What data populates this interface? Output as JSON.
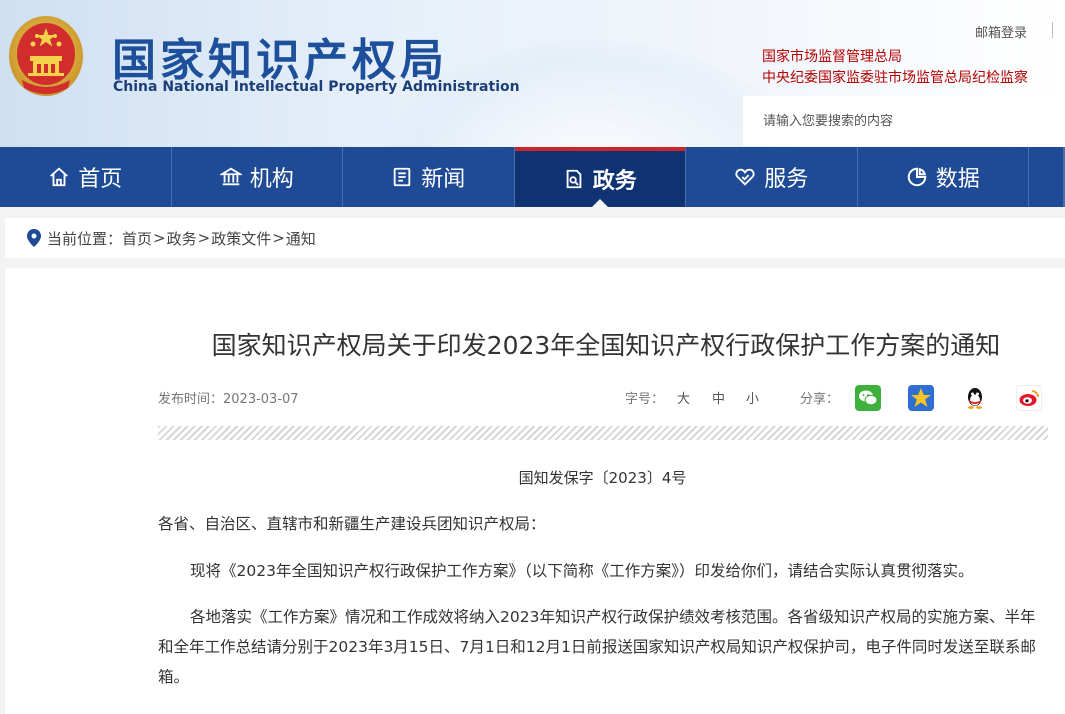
{
  "header": {
    "title": "国家知识产权局",
    "subtitle": "China National Intellectual Property Administration",
    "email_login": "邮箱登录",
    "related_links": [
      "国家市场监督管理总局",
      "中央纪委国家监委驻市场监管总局纪检监察"
    ],
    "search_placeholder": "请输入您要搜索的内容"
  },
  "nav": {
    "items": [
      {
        "label": "首页",
        "icon": "home-icon"
      },
      {
        "label": "机构",
        "icon": "institution-icon"
      },
      {
        "label": "新闻",
        "icon": "news-icon"
      },
      {
        "label": "政务",
        "icon": "government-affairs-icon",
        "active": true
      },
      {
        "label": "服务",
        "icon": "service-icon"
      },
      {
        "label": "数据",
        "icon": "data-icon"
      }
    ]
  },
  "breadcrumb": {
    "prefix": "当前位置：",
    "items": [
      "首页",
      "政务",
      "政策文件",
      "通知"
    ],
    "separator": ">"
  },
  "article": {
    "title": "国家知识产权局关于印发2023年全国知识产权行政保护工作方案的通知",
    "publish_label": "发布时间：",
    "publish_date": "2023-03-07",
    "font_size_label": "字号：",
    "font_options": [
      "大",
      "中",
      "小"
    ],
    "share_label": "分享：",
    "share_targets": [
      "wechat-icon",
      "qzone-icon",
      "qq-icon",
      "weibo-icon"
    ],
    "doc_number": "国知发保字〔2023〕4号",
    "salutation": "各省、自治区、直辖市和新疆生产建设兵团知识产权局：",
    "paragraphs": [
      "现将《2023年全国知识产权行政保护工作方案》（以下简称《工作方案》）印发给你们，请结合实际认真贯彻落实。",
      "各地落实《工作方案》情况和工作成效将纳入2023年知识产权行政保护绩效考核范围。各省级知识产权局的实施方案、半年和全年工作总结请分别于2023年3月15日、7月1日和12月1日前报送国家知识产权局知识产权保护司，电子件同时发送至联系邮箱。"
    ]
  },
  "colors": {
    "nav_bg": "#1f4b96",
    "nav_active_bg": "#0f3272",
    "nav_active_top": "#c9262b",
    "title_blue": "#1d4f9a",
    "link_red": "#b30000"
  }
}
